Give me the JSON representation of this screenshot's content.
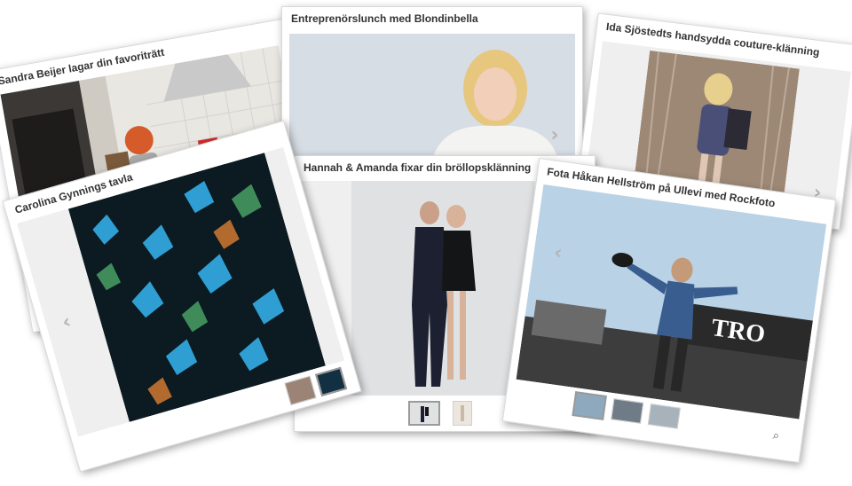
{
  "cards": [
    {
      "id": "sandra",
      "title": "Sandra Beijer lagar din favoriträtt"
    },
    {
      "id": "blondinbella",
      "title": "Entreprenörslunch med Blondinbella"
    },
    {
      "id": "ida",
      "title": "Ida Sjöstedts handsydda couture-klänning"
    },
    {
      "id": "carolina",
      "title": "Carolina Gynnings tavla"
    },
    {
      "id": "hannah",
      "title": "Hannah & Amanda fixar din bröllopsklänning"
    },
    {
      "id": "hakan",
      "title": "Fota Håkan Hellström på Ullevi med Rockfoto"
    }
  ],
  "stage_sign_text": "TRO",
  "icons": {
    "prev": "chevron-left-icon",
    "next": "chevron-right-icon",
    "zoom": "magnifier-icon"
  },
  "colors": {
    "card_border": "#d9d9d9",
    "photo_bg": "#efefef",
    "arrow": "#b5b5b5",
    "title": "#333333"
  }
}
